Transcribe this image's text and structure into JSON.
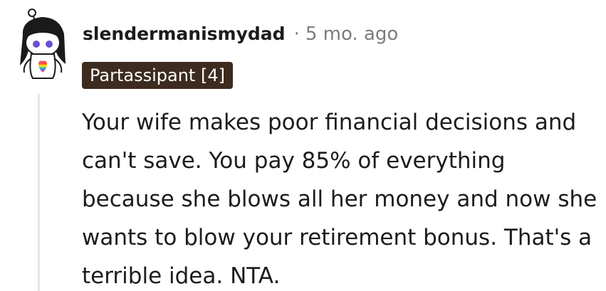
{
  "comment": {
    "author": "slendermanismydad",
    "separator": "·",
    "timestamp": "5 mo. ago",
    "flair": "Partassipant [4]",
    "body": "Your wife makes poor financial decisions and can't save. You pay 85% of everything because she blows all her money and now she wants to blow your retirement bonus. That's a terrible idea. NTA."
  },
  "colors": {
    "flair_background": "#3d2b1f",
    "text": "#1c1c1c",
    "muted": "#7c7c7c",
    "thread_line": "#e4e6e8"
  },
  "icons": {
    "avatar": "snoo-avatar-with-rainbow-heart"
  }
}
